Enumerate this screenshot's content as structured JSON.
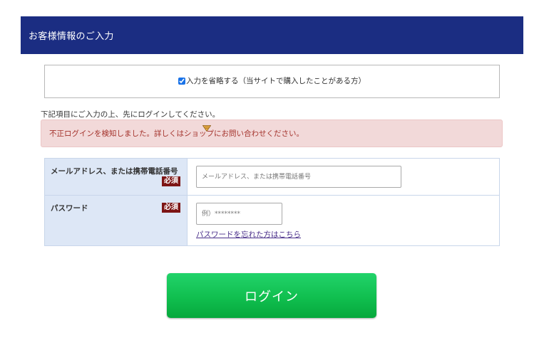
{
  "header": {
    "title": "お客様情報のご入力"
  },
  "skip": {
    "checked": true,
    "label": "入力を省略する（当サイトで購入したことがある方）"
  },
  "instruction": "下記項目にご入力の上、先にログインしてください。",
  "alert": {
    "message": "不正ログインを検知しました。詳しくはショップにお問い合わせください。"
  },
  "form": {
    "email": {
      "label": "メールアドレス、または携帯電話番号",
      "required": "必須",
      "placeholder": "メールアドレス、または携帯電話番号",
      "value": ""
    },
    "password": {
      "label": "パスワード",
      "required": "必須",
      "placeholder": "例）********",
      "value": "",
      "forgot_link": "パスワードを忘れた方はこちら"
    }
  },
  "login_button": "ログイン",
  "colors": {
    "header_bg": "#1b2d82",
    "alert_bg": "#f2d9d9",
    "alert_text": "#a4332c",
    "required_bg": "#7d1515",
    "label_bg": "#dde7f6",
    "button_green": "#10bf4f"
  }
}
